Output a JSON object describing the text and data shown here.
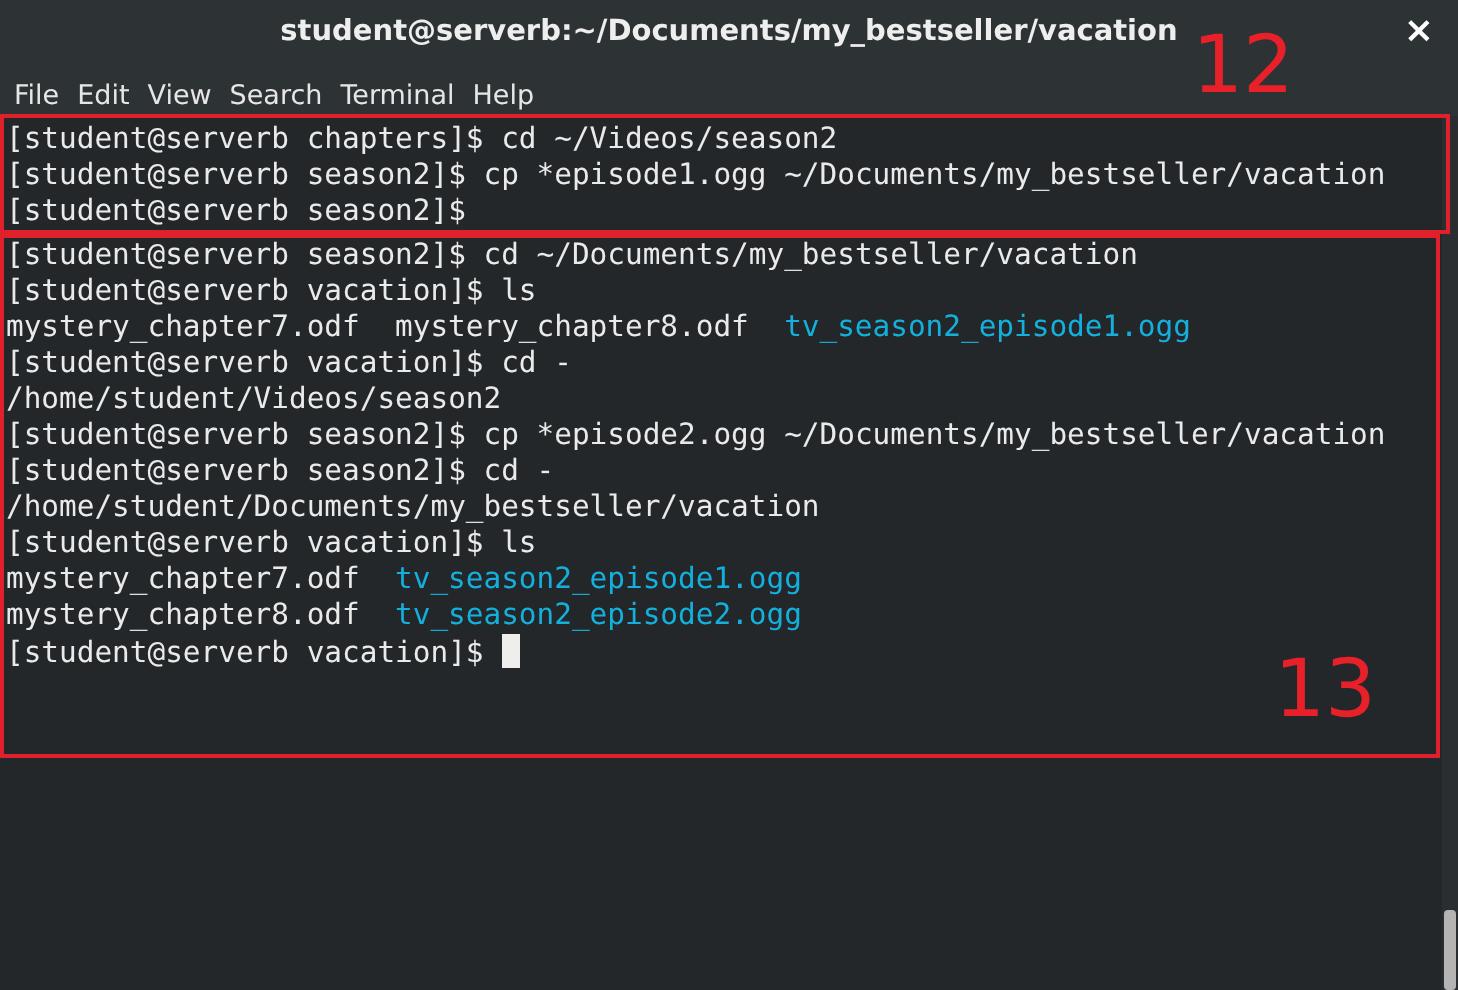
{
  "window": {
    "title": "student@serverb:~/Documents/my_bestseller/vacation",
    "close": "×"
  },
  "menu": [
    "File",
    "Edit",
    "View",
    "Search",
    "Terminal",
    "Help"
  ],
  "terminal": {
    "groups": [
      {
        "annotation": "12",
        "lines": [
          {
            "segments": [
              {
                "text": "[student@serverb chapters]$ cd ~/Videos/season2",
                "kind": "text"
              }
            ]
          },
          {
            "segments": [
              {
                "text": "[student@serverb season2]$ cp *episode1.ogg ~/Documents/my_bestseller/vacation",
                "kind": "text"
              }
            ]
          },
          {
            "segments": [
              {
                "text": "[student@serverb season2]$",
                "kind": "text"
              }
            ]
          }
        ]
      },
      {
        "annotation": "13",
        "lines": [
          {
            "segments": [
              {
                "text": "[student@serverb season2]$ cd ~/Documents/my_bestseller/vacation",
                "kind": "text"
              }
            ]
          },
          {
            "segments": [
              {
                "text": "[student@serverb vacation]$ ls",
                "kind": "text"
              }
            ]
          },
          {
            "segments": [
              {
                "text": "mystery_chapter7.odf",
                "kind": "text"
              },
              {
                "text": "mystery_chapter8.odf",
                "kind": "text"
              },
              {
                "text": "tv_season2_episode1.ogg",
                "kind": "media"
              }
            ]
          },
          {
            "segments": [
              {
                "text": "[student@serverb vacation]$ cd -",
                "kind": "text"
              }
            ]
          },
          {
            "segments": [
              {
                "text": "/home/student/Videos/season2",
                "kind": "text"
              }
            ]
          },
          {
            "segments": [
              {
                "text": "[student@serverb season2]$ cp *episode2.ogg ~/Documents/my_bestseller/vacation",
                "kind": "text"
              }
            ]
          },
          {
            "segments": [
              {
                "text": "[student@serverb season2]$ cd -",
                "kind": "text"
              }
            ]
          },
          {
            "segments": [
              {
                "text": "/home/student/Documents/my_bestseller/vacation",
                "kind": "text"
              }
            ]
          },
          {
            "segments": [
              {
                "text": "[student@serverb vacation]$ ls",
                "kind": "text"
              }
            ]
          },
          {
            "segments": [
              {
                "text": "mystery_chapter7.odf",
                "kind": "text"
              },
              {
                "text": "tv_season2_episode1.ogg",
                "kind": "media"
              }
            ]
          },
          {
            "segments": [
              {
                "text": "mystery_chapter8.odf",
                "kind": "text"
              },
              {
                "text": "tv_season2_episode2.ogg",
                "kind": "media"
              }
            ]
          },
          {
            "segments": [
              {
                "text": "[student@serverb vacation]$",
                "kind": "text"
              }
            ],
            "cursor": true
          }
        ]
      }
    ]
  }
}
